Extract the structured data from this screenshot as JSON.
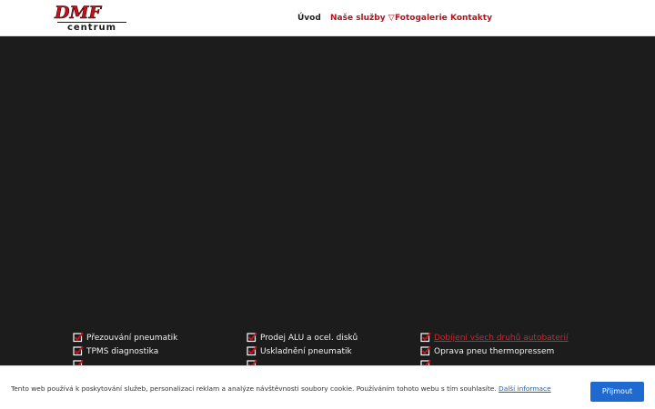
{
  "logo": {
    "main": "DMF",
    "sub": "centrum"
  },
  "nav": {
    "items": [
      {
        "label": "Úvod"
      },
      {
        "label": "Naše služby ▽"
      },
      {
        "label": "Fotogalerie"
      },
      {
        "label": "Kontakty"
      }
    ]
  },
  "services": {
    "col1": [
      "Přezouvání pneumatik",
      "TPMS diagnostika"
    ],
    "col2": [
      "Prodej ALU a ocel. disků",
      "Uskladnění pneumatik"
    ],
    "col3": [
      "Dobíjení všech druhů autobaterií",
      "Oprava pneu thermopressem"
    ]
  },
  "cookie": {
    "text": "Tento web používá k poskytování služeb, personalizaci reklam a analýze návštěvnosti soubory cookie. Používáním tohoto webu s tím souhlasíte.",
    "link": "Další informace",
    "accept": "Přijmout"
  },
  "colors": {
    "brand_red": "#b5121b",
    "accept_blue": "#1e6ad1",
    "check_red": "#c8101b"
  },
  "icons": {
    "check": "check-icon"
  }
}
